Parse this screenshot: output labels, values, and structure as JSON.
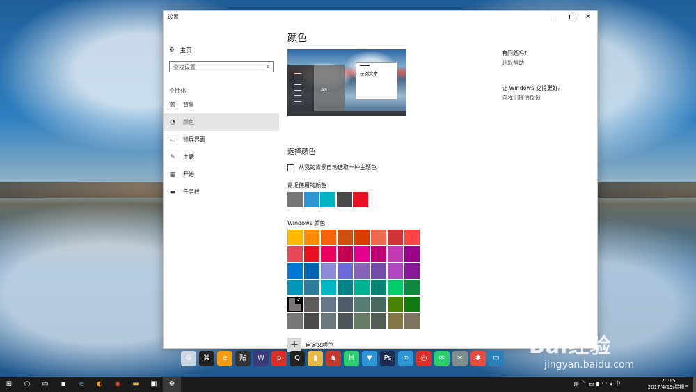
{
  "window": {
    "title": "设置",
    "controls": {
      "minimize": "–",
      "maximize": "",
      "close": "✕"
    }
  },
  "sidebar": {
    "home": "主页",
    "search_placeholder": "查找设置",
    "section": "个性化",
    "items": [
      {
        "label": "背景",
        "icon": "picture-icon",
        "active": false
      },
      {
        "label": "颜色",
        "icon": "palette-icon",
        "active": true
      },
      {
        "label": "锁屏界面",
        "icon": "lock-screen-icon",
        "active": false
      },
      {
        "label": "主题",
        "icon": "theme-icon",
        "active": false
      },
      {
        "label": "开始",
        "icon": "start-icon",
        "active": false
      },
      {
        "label": "任务栏",
        "icon": "taskbar-icon",
        "active": false
      }
    ]
  },
  "content": {
    "title": "颜色",
    "preview": {
      "tile_text": "Aa",
      "window_text": "示例文本"
    },
    "choose_heading": "选择颜色",
    "auto_pick_label": "从我的背景自动选取一种主题色",
    "auto_pick_checked": false,
    "recent_label": "最近使用的颜色",
    "recent_colors": [
      "#767676",
      "#2d95d4",
      "#00b4c4",
      "#4c4a48",
      "#e81123"
    ],
    "windows_label": "Windows 颜色",
    "windows_colors": [
      "#ffb900",
      "#ff8c00",
      "#f7630c",
      "#ca5010",
      "#da3b01",
      "#ef6950",
      "#d13438",
      "#ff4343",
      "#e74856",
      "#e81123",
      "#ea005e",
      "#c30052",
      "#e3008c",
      "#bf0077",
      "#c239b3",
      "#9a0089",
      "#0078d7",
      "#0063b1",
      "#8e8cd8",
      "#6b69d6",
      "#8764b8",
      "#744da9",
      "#b146c2",
      "#881798",
      "#0099bc",
      "#2d7d9a",
      "#00b7c3",
      "#038387",
      "#00b294",
      "#018574",
      "#00cc6a",
      "#10893e",
      "#7a7574",
      "#5d5a58",
      "#68768a",
      "#515c6b",
      "#567c73",
      "#486860",
      "#498205",
      "#107c10",
      "#767676",
      "#4c4a48",
      "#69797e",
      "#4a5459",
      "#647c64",
      "#525e54",
      "#847545",
      "#7e735f"
    ],
    "selected_index": 32,
    "custom_label": "自定义颜色"
  },
  "help": {
    "question": "有问题吗?",
    "get_help": "获取帮助",
    "improve": "让 Windows 变得更好。",
    "feedback": "向我们提供反馈"
  },
  "watermark": {
    "brand": "Bai经验",
    "url": "jingyan.baidu.com"
  },
  "dock_apps": [
    {
      "name": "recycle-bin-icon",
      "glyph": "♻",
      "color": "#c9d6e3"
    },
    {
      "name": "swan-icon",
      "glyph": "⌘",
      "color": "#222222"
    },
    {
      "name": "browser-icon",
      "glyph": "e",
      "color": "#f39c12"
    },
    {
      "name": "tieba-icon",
      "glyph": "贴",
      "color": "#333333"
    },
    {
      "name": "wizard-icon",
      "glyph": "W",
      "color": "#3a3a7a"
    },
    {
      "name": "p-app-icon",
      "glyph": "p",
      "color": "#d9302a"
    },
    {
      "name": "qq-icon",
      "glyph": "Q",
      "color": "#222222"
    },
    {
      "name": "folder-icon",
      "glyph": "▮",
      "color": "#e6b84a"
    },
    {
      "name": "game-icon",
      "glyph": "♞",
      "color": "#c0392b"
    },
    {
      "name": "h-app-icon",
      "glyph": "H",
      "color": "#2ecc71"
    },
    {
      "name": "bookmark-icon",
      "glyph": "▼",
      "color": "#2d95d4"
    },
    {
      "name": "photoshop-icon",
      "glyph": "Ps",
      "color": "#1d2b4f"
    },
    {
      "name": "baidu-cloud-icon",
      "glyph": "∞",
      "color": "#2d95d4"
    },
    {
      "name": "netease-music-icon",
      "glyph": "◎",
      "color": "#d9302a"
    },
    {
      "name": "wechat-icon",
      "glyph": "✉",
      "color": "#2ecc71"
    },
    {
      "name": "scissors-icon",
      "glyph": "✂",
      "color": "#7f8c8d"
    },
    {
      "name": "cleaner-icon",
      "glyph": "✱",
      "color": "#e74c3c"
    },
    {
      "name": "remote-icon",
      "glyph": "▭",
      "color": "#2980b9"
    }
  ],
  "taskbar": {
    "clock_time": "20:15",
    "clock_date": "2017/4/19/星期三"
  }
}
